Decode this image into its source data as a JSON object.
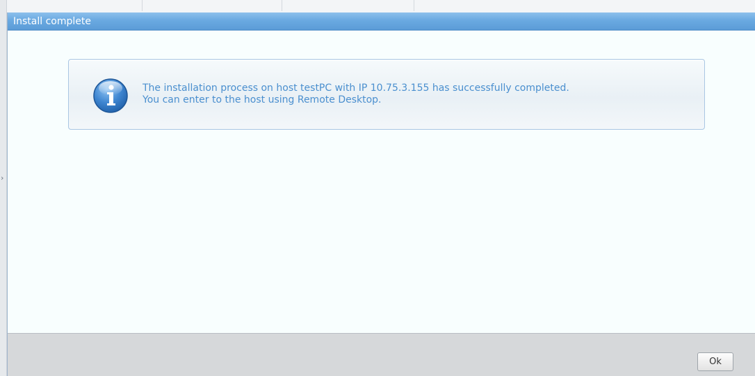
{
  "dialog": {
    "title": "Install complete",
    "message_icon": "info-icon",
    "message_lines": [
      "The installation process on host testPC with IP 10.75.3.155 has successfully completed.",
      "You can enter to the host using Remote Desktop."
    ],
    "ok_label": "Ok"
  },
  "colors": {
    "titlebar": "#6aa9e1",
    "message_text": "#4a8fcf",
    "footer": "#d6d8da"
  }
}
